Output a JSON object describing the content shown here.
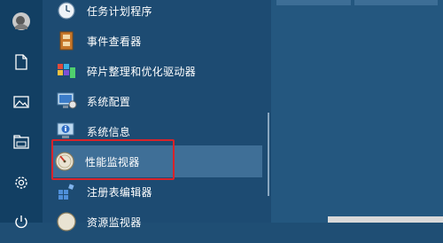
{
  "start_menu": {
    "apps": [
      {
        "label": "任务计划程序",
        "icon": "clock-icon"
      },
      {
        "label": "事件查看器",
        "icon": "event-viewer-icon"
      },
      {
        "label": "碎片整理和优化驱动器",
        "icon": "defrag-icon"
      },
      {
        "label": "系统配置",
        "icon": "system-config-icon"
      },
      {
        "label": "系统信息",
        "icon": "system-info-icon"
      },
      {
        "label": "性能监视器",
        "icon": "performance-monitor-icon",
        "selected": true
      },
      {
        "label": "注册表编辑器",
        "icon": "registry-editor-icon"
      },
      {
        "label": "资源监视器",
        "icon": "resource-monitor-icon"
      }
    ],
    "rail": [
      "user-avatar-icon",
      "documents-icon",
      "pictures-icon",
      "file-explorer-icon",
      "settings-icon",
      "power-icon"
    ]
  },
  "colors": {
    "rail_bg": "#123f63",
    "list_bg": "#1d4b72",
    "hover_bg": "#3f6f97",
    "highlight_border": "#d8232a"
  }
}
